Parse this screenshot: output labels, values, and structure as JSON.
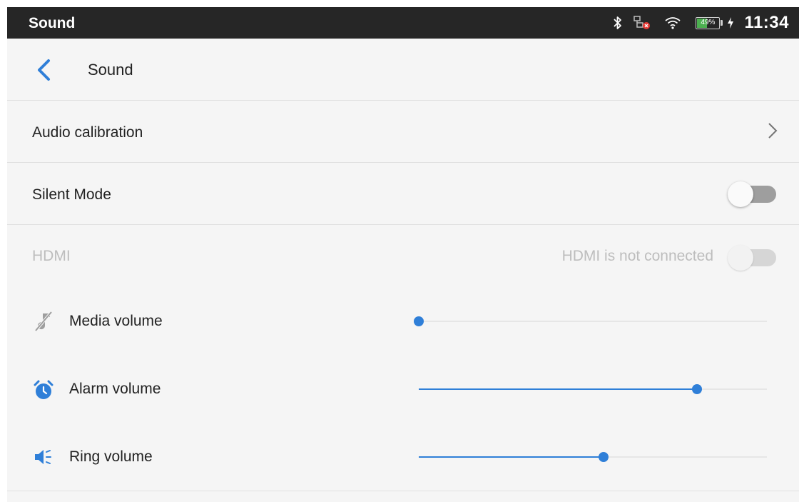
{
  "status_bar": {
    "app_title": "Sound",
    "battery_percent": 49,
    "battery_label": "49%",
    "time": "11:34",
    "icons": [
      "bluetooth-icon",
      "network-disconnected-icon",
      "wifi-icon",
      "battery-icon",
      "charging-icon"
    ]
  },
  "toolbar": {
    "title": "Sound",
    "back_icon": "back-arrow-icon"
  },
  "settings": {
    "audio_calibration": {
      "label": "Audio calibration",
      "icon": "chevron-right-icon"
    },
    "silent_mode": {
      "label": "Silent Mode",
      "enabled": false
    },
    "hdmi": {
      "label": "HDMI",
      "status": "HDMI is not connected",
      "enabled": false,
      "disabled": true
    }
  },
  "volumes": [
    {
      "label": "Media volume",
      "icon": "media-muted-icon",
      "level": 0.0
    },
    {
      "label": "Alarm volume",
      "icon": "alarm-clock-icon",
      "level": 0.8
    },
    {
      "label": "Ring volume",
      "icon": "ring-volume-icon",
      "level": 0.53
    }
  ],
  "colors": {
    "accent": "#2f7fd8",
    "status_bar_bg": "#262626",
    "background": "#f5f5f5",
    "battery_green": "#4caf50"
  }
}
